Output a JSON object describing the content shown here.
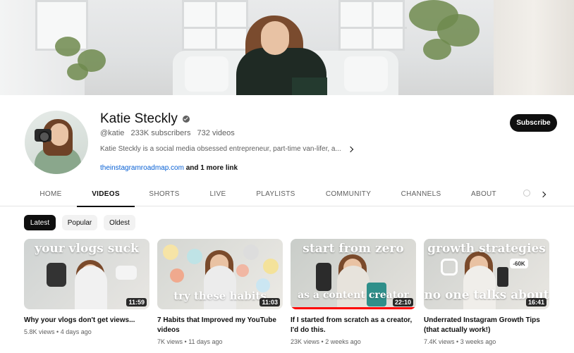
{
  "channel": {
    "name": "Katie Steckly",
    "handle": "@katie",
    "subscribers": "233K subscribers",
    "video_count": "732 videos",
    "description": "Katie Steckly is a social media obsessed entrepreneur, part-time van-lifer, a...",
    "link": "theinstagramroadmap.com",
    "more_links": "and 1 more link",
    "subscribe_label": "Subscribe"
  },
  "tabs": [
    {
      "label": "HOME",
      "active": false
    },
    {
      "label": "VIDEOS",
      "active": true
    },
    {
      "label": "SHORTS",
      "active": false
    },
    {
      "label": "LIVE",
      "active": false
    },
    {
      "label": "PLAYLISTS",
      "active": false
    },
    {
      "label": "COMMUNITY",
      "active": false
    },
    {
      "label": "CHANNELS",
      "active": false
    },
    {
      "label": "ABOUT",
      "active": false
    }
  ],
  "filters": [
    {
      "label": "Latest",
      "active": true
    },
    {
      "label": "Popular",
      "active": false
    },
    {
      "label": "Oldest",
      "active": false
    }
  ],
  "videos": [
    {
      "title": "Why your vlogs don't get views...",
      "views": "5.8K views",
      "age": "4 days ago",
      "duration": "11:59",
      "thumb_text_top": "your vlogs suck",
      "thumb_text_bottom": ""
    },
    {
      "title": "7 Habits that Improved my YouTube videos",
      "views": "7K views",
      "age": "11 days ago",
      "duration": "11:03",
      "thumb_text_top": "",
      "thumb_text_bottom": "try these habits"
    },
    {
      "title": "If I started from scratch as a creator, I'd do this.",
      "views": "23K views",
      "age": "2 weeks ago",
      "duration": "22:10",
      "thumb_text_top": "start from zero",
      "thumb_text_bottom": "as a content creator"
    },
    {
      "title": "Underrated Instagram Growth Tips (that actually work!)",
      "views": "7.4K views",
      "age": "3 weeks ago",
      "duration": "16:41",
      "thumb_text_top": "growth strategies",
      "thumb_text_bottom": "no one talks about",
      "thumb_badge": "-60K"
    }
  ],
  "icons": {
    "verified": "verified-check-icon",
    "description_expand": "chevron-right-icon",
    "tabs_next": "chevron-right-icon",
    "tabs_search": "search-icon"
  }
}
